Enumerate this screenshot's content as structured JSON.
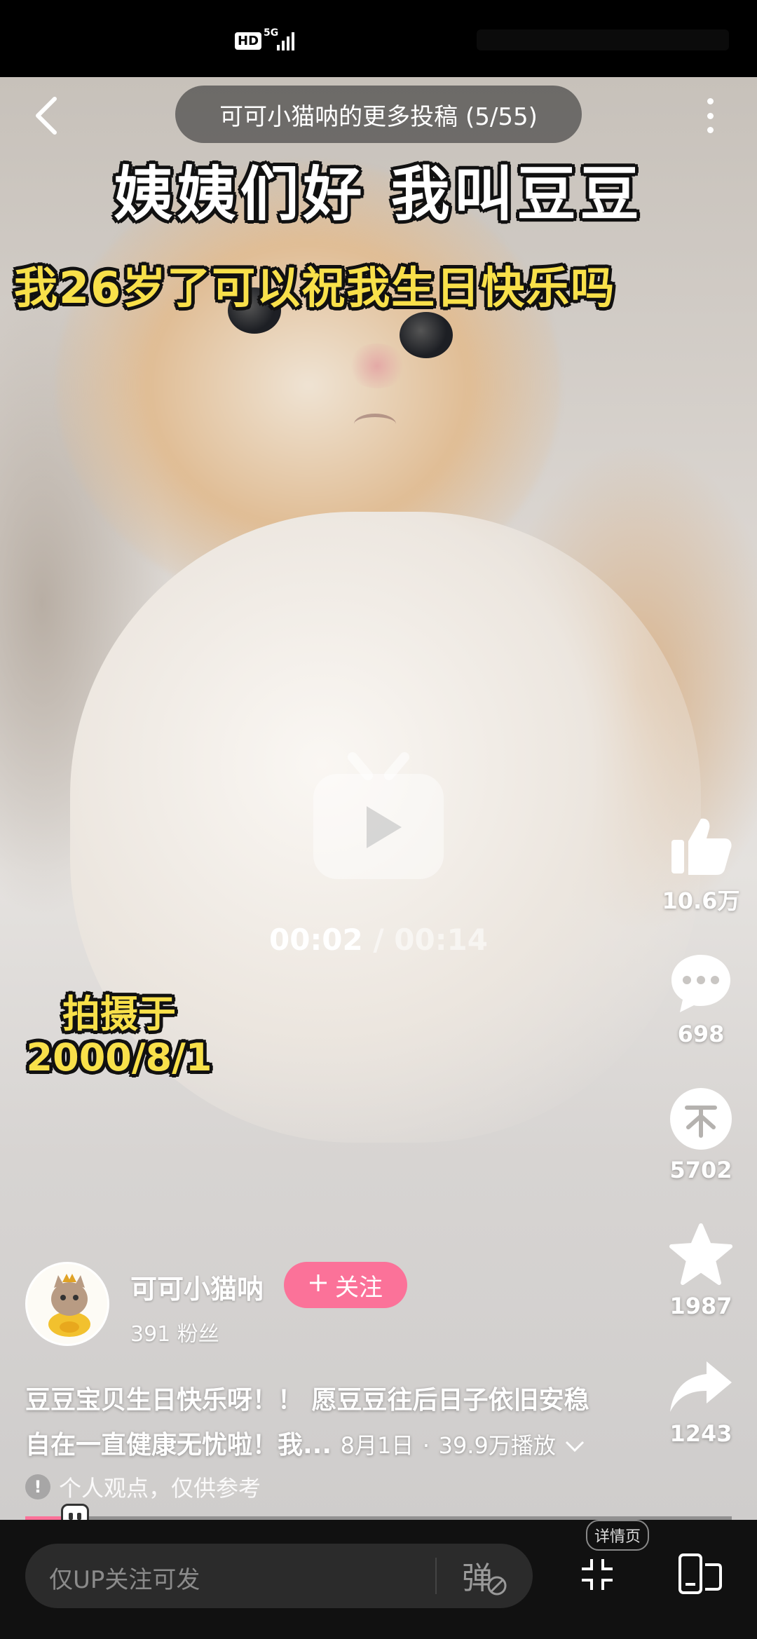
{
  "status_bar": {
    "hd": "HD",
    "network": "5G"
  },
  "header": {
    "title": "可可小猫呐的更多投稿 (5/55)",
    "back_icon": "back-arrow-icon",
    "more_icon": "more-vertical-icon"
  },
  "video": {
    "caption_line1": "姨姨们好  我叫豆豆",
    "caption_line2": "我26岁了可以祝我生日快乐吗",
    "caption_date_line1": "拍摄于",
    "caption_date_line2": "2000/8/1",
    "current_time": "00:02",
    "time_separator": " / ",
    "duration": "00:14",
    "progress_fraction": 0.07
  },
  "actions": {
    "like": {
      "count": "10.6万",
      "icon": "thumbs-up-icon"
    },
    "comment": {
      "count": "698",
      "icon": "comment-icon"
    },
    "coin": {
      "count": "5702",
      "icon": "coin-icon"
    },
    "favorite": {
      "count": "1987",
      "icon": "star-icon"
    },
    "share": {
      "count": "1243",
      "icon": "share-icon"
    }
  },
  "author": {
    "name": "可可小猫呐",
    "fans": "391 粉丝",
    "follow_label": "关注"
  },
  "description": {
    "text_line1": "豆豆宝贝生日快乐呀！！ 愿豆豆往后日子依旧安稳",
    "text_line2": "自在一直健康无忧啦！我...",
    "date": "8月1日",
    "dot": "·",
    "views": "39.9万播放"
  },
  "notice": "个人观点，仅供参考",
  "bottom_bar": {
    "comment_placeholder": "仅UP关注可发",
    "danmaku_icon": "danmaku-disabled-icon",
    "detail_label": "详情页"
  },
  "colors": {
    "accent": "#fb7299",
    "caption_yellow": "#f8e04a"
  }
}
